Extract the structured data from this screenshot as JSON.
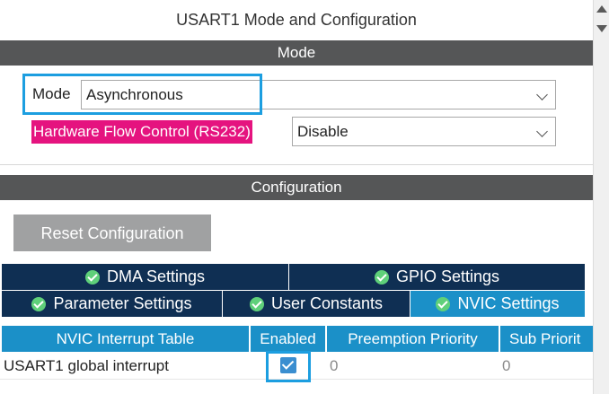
{
  "window": {
    "title": "USART1 Mode and Configuration"
  },
  "mode_section": {
    "header": "Mode",
    "mode_label": "Mode",
    "mode_value": "Asynchronous",
    "hfc_label": "Hardware Flow Control (RS232)",
    "hfc_value": "Disable"
  },
  "config_section": {
    "header": "Configuration",
    "reset_button": "Reset Configuration"
  },
  "tabs": [
    {
      "label": "DMA Settings",
      "icon": "check-circle-icon",
      "active": false
    },
    {
      "label": "GPIO Settings",
      "icon": "check-circle-icon",
      "active": false
    },
    {
      "label": "Parameter Settings",
      "icon": "check-circle-icon",
      "active": false
    },
    {
      "label": "User Constants",
      "icon": "check-circle-icon",
      "active": false
    },
    {
      "label": "NVIC Settings",
      "icon": "check-circle-icon",
      "active": true
    }
  ],
  "nvic_table": {
    "columns": [
      "NVIC Interrupt Table",
      "Enabled",
      "Preemption Priority",
      "Sub Priorit"
    ],
    "rows": [
      {
        "name": "USART1 global interrupt",
        "enabled": true,
        "preemption": "0",
        "sub": "0"
      }
    ]
  },
  "colors": {
    "header_bg": "#555657",
    "tab_bg": "#0f2f53",
    "tab_active_bg": "#1b90c8",
    "highlight": "#1c9ee0",
    "hfc_label_bg": "#e5137f",
    "check_green": "#5fd07a"
  }
}
